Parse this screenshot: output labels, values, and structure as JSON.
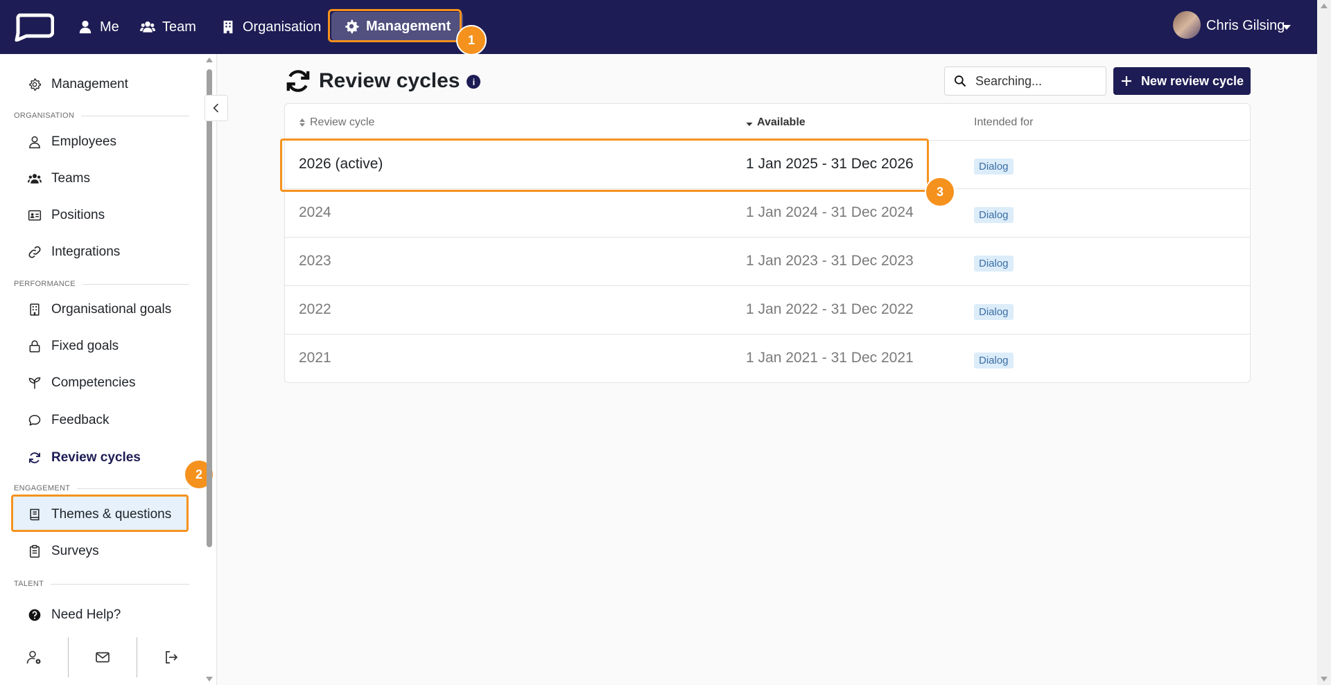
{
  "nav": {
    "me": "Me",
    "team": "Team",
    "organisation": "Organisation",
    "management": "Management",
    "user_name": "Chris Gilsing"
  },
  "badges": {
    "one": "1",
    "two": "2",
    "three": "3"
  },
  "sidebar": {
    "management": "Management",
    "section_organisation": "ORGANISATION",
    "employees": "Employees",
    "teams": "Teams",
    "positions": "Positions",
    "integrations": "Integrations",
    "section_performance": "PERFORMANCE",
    "organisational_goals": "Organisational goals",
    "fixed_goals": "Fixed goals",
    "competencies": "Competencies",
    "feedback": "Feedback",
    "review_cycles": "Review cycles",
    "section_engagement": "ENGAGEMENT",
    "themes_questions": "Themes & questions",
    "surveys": "Surveys",
    "section_talent": "TALENT",
    "need_help": "Need Help?"
  },
  "page": {
    "title": "Review cycles",
    "info": "i",
    "search_placeholder": "Searching...",
    "new_button": "New review cycle"
  },
  "table": {
    "headers": {
      "cycle": "Review cycle",
      "available": "Available",
      "intended_for": "Intended for"
    },
    "rows": [
      {
        "cycle": "2026 (active)",
        "available": "1 Jan 2025 - 31 Dec 2026",
        "intended_for": "Dialog"
      },
      {
        "cycle": "2024",
        "available": "1 Jan 2024 - 31 Dec 2024",
        "intended_for": "Dialog"
      },
      {
        "cycle": "2023",
        "available": "1 Jan 2023 - 31 Dec 2023",
        "intended_for": "Dialog"
      },
      {
        "cycle": "2022",
        "available": "1 Jan 2022 - 31 Dec 2022",
        "intended_for": "Dialog"
      },
      {
        "cycle": "2021",
        "available": "1 Jan 2021 - 31 Dec 2021",
        "intended_for": "Dialog"
      }
    ]
  },
  "colors": {
    "nav_bg": "#1d1c54",
    "highlight": "#f5921e",
    "active_bg": "#e6f1fb",
    "tag_bg": "#dcecf9"
  }
}
